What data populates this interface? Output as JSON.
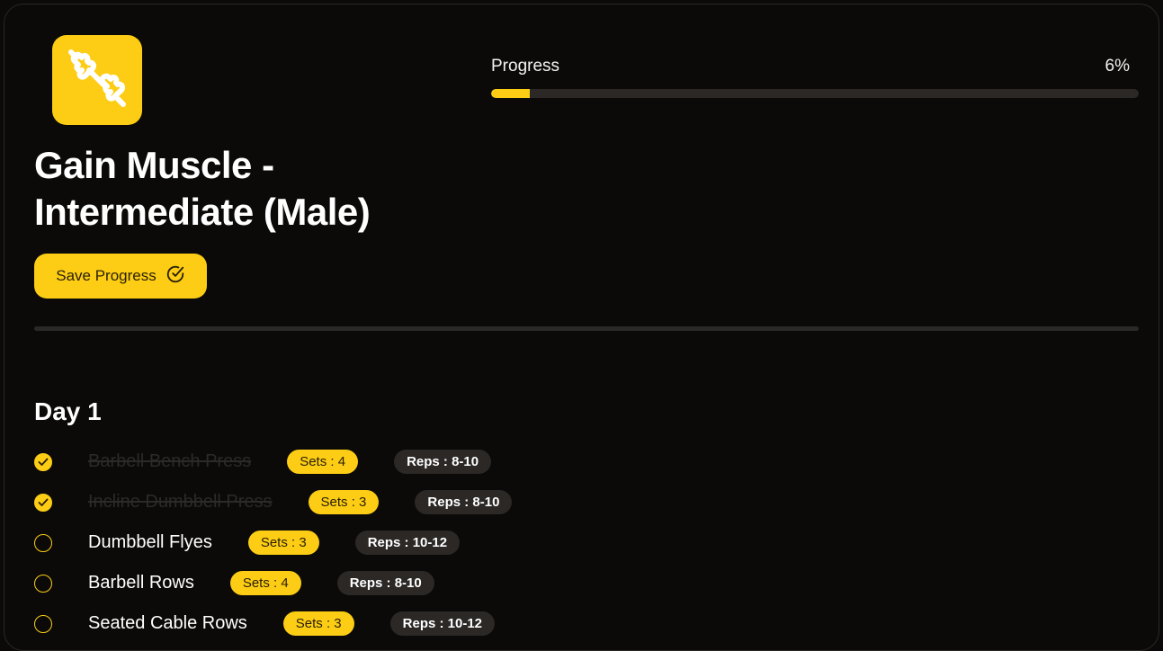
{
  "program": {
    "title": "Gain Muscle - Intermediate (Male)",
    "logo_icon": "dumbbell-icon"
  },
  "actions": {
    "save_label": "Save Progress",
    "save_icon": "check-circle-icon"
  },
  "progress": {
    "label": "Progress",
    "value_text": "6%",
    "percent": 6
  },
  "colors": {
    "accent": "#fccd14",
    "background": "#0b0a09",
    "track": "#2b2826"
  },
  "days": [
    {
      "title": "Day 1",
      "exercises": [
        {
          "name": "Barbell Bench Press",
          "sets": "Sets : 4",
          "reps": "Reps : 8-10",
          "done": true
        },
        {
          "name": "Incline Dumbbell Press",
          "sets": "Sets : 3",
          "reps": "Reps : 8-10",
          "done": true
        },
        {
          "name": "Dumbbell Flyes",
          "sets": "Sets : 3",
          "reps": "Reps : 10-12",
          "done": false
        },
        {
          "name": "Barbell Rows",
          "sets": "Sets : 4",
          "reps": "Reps : 8-10",
          "done": false
        },
        {
          "name": "Seated Cable Rows",
          "sets": "Sets : 3",
          "reps": "Reps : 10-12",
          "done": false
        }
      ]
    }
  ]
}
